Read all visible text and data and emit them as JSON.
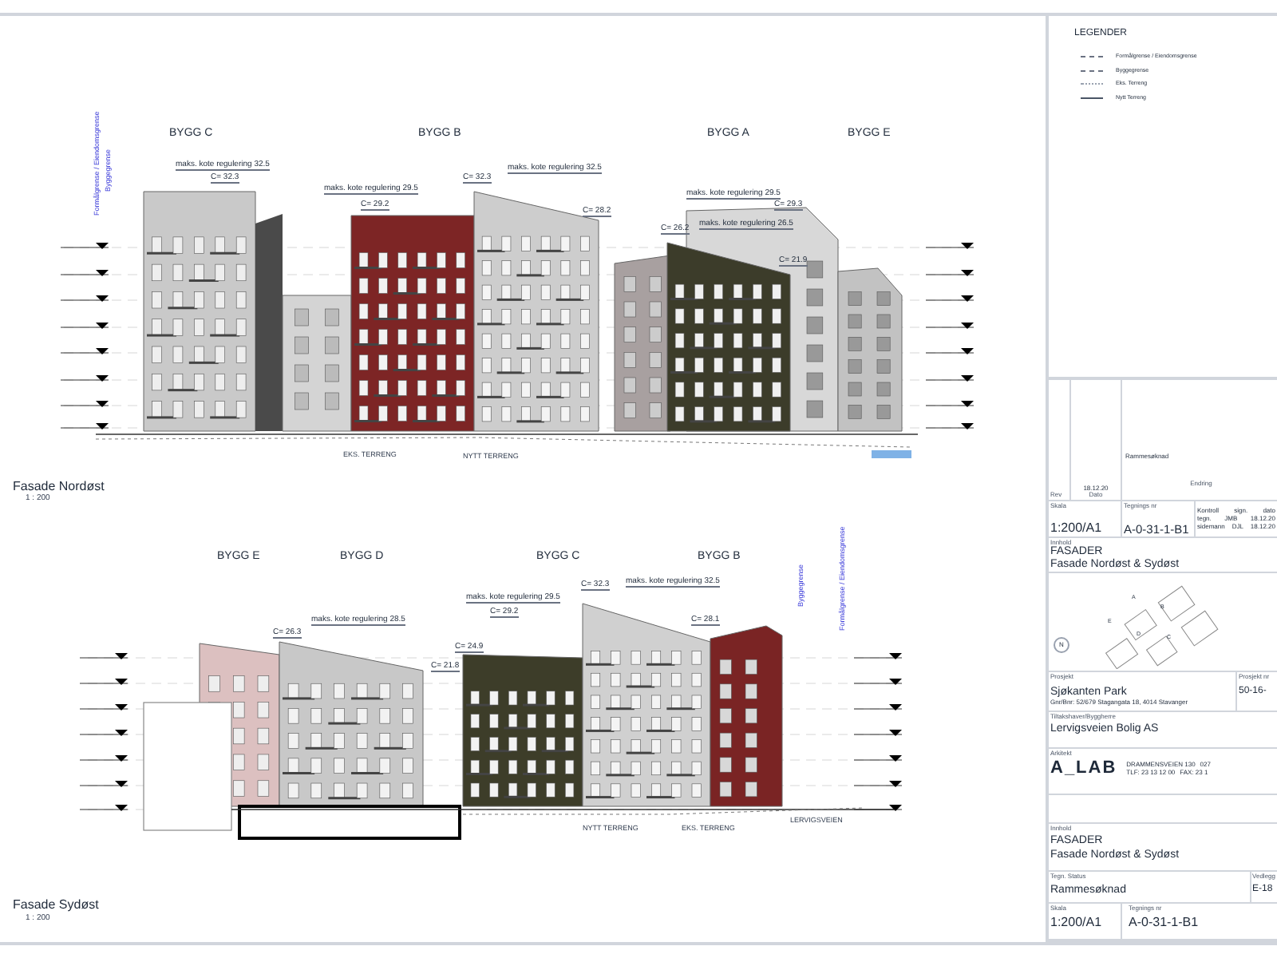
{
  "facades": [
    {
      "title": "Fasade Nordøst",
      "scale": "1 : 200",
      "buildings": [
        "BYGG C",
        "BYGG B",
        "BYGG A",
        "BYGG E"
      ],
      "annotations": [
        "maks. kote regulering 32.5",
        "C= 32.3",
        "maks. kote regulering 29.5",
        "C= 29.2",
        "C= 32.3",
        "maks. kote regulering 32.5",
        "C= 28.2",
        "maks. kote regulering 29.5",
        "C= 29.3",
        "maks. kote regulering 26.5",
        "C= 26.2",
        "C= 21.9"
      ],
      "terrain_labels": [
        "EKS. TERRENG",
        "NYTT TERRENG"
      ],
      "boundary_labels": [
        "Formålgrense / Eiendomsgrense",
        "Byggegrense"
      ]
    },
    {
      "title": "Fasade Sydøst",
      "scale": "1 : 200",
      "buildings": [
        "BYGG E",
        "BYGG D",
        "BYGG C",
        "BYGG B"
      ],
      "annotations": [
        "maks. kote regulering 28.5",
        "C= 26.3",
        "C= 21.8",
        "C= 24.9",
        "maks. kote regulering 29.5",
        "C= 29.2",
        "C= 32.3",
        "maks. kote regulering 32.5",
        "C= 28.1"
      ],
      "terrain_labels": [
        "NYTT TERRENG",
        "EKS. TERRENG",
        "LERVIGSVEIEN"
      ],
      "boundary_labels": [
        "Byggegrense",
        "Formålgrense / Eiendomsgrense"
      ]
    }
  ],
  "legend": {
    "title": "LEGENDER",
    "items": [
      {
        "label": "Formålgrense / Eiendomsgrense",
        "kind": "dashed"
      },
      {
        "label": "Byggegrense",
        "kind": "dashed"
      },
      {
        "label": "Eks. Terreng",
        "kind": "dotted"
      },
      {
        "label": "Nytt Terreng",
        "kind": "solid"
      }
    ]
  },
  "revision": {
    "date": "18.12.20",
    "change": "Rammesøknad",
    "headers": [
      "Rev",
      "Dato",
      "Endring"
    ]
  },
  "scale_row": {
    "scale_label": "Skala",
    "scale": "1:200/A1",
    "drawing_no_label": "Tegnings nr",
    "drawing_no": "A-0-31-1-B1",
    "control": [
      [
        "Kontroll",
        "sign.",
        "dato"
      ],
      [
        "tegn.",
        "JMB",
        "18.12.20"
      ],
      [
        "sidemann",
        "DJL",
        "18.12.20"
      ]
    ]
  },
  "content": {
    "label": "Innhold",
    "title": "FASADER",
    "subtitle": "Fasade Nordøst & Sydøst"
  },
  "site_plan": {
    "north": "N",
    "buildings": [
      "E",
      "A",
      "B",
      "D",
      "C"
    ]
  },
  "project": {
    "label": "Prosjekt",
    "name": "Sjøkanten Park",
    "address": "Gnr/Bnr: 52/679 Stagangata 18, 4014 Stavanger",
    "number_label": "Prosjekt nr",
    "number": "50-16-"
  },
  "client": {
    "label": "Tiltakshaver/Byggherre",
    "name": "Lervigsveien Bolig AS"
  },
  "architect": {
    "label": "Arkitekt",
    "logo": "A_LAB",
    "address": "DRAMMENSVEIEN 130",
    "address_cut": "027",
    "phone": "TLF: 23 13 12 00",
    "fax": "FAX: 23 1"
  },
  "content_repeat": {
    "label": "Innhold",
    "title": "FASADER",
    "subtitle": "Fasade Nordøst & Sydøst"
  },
  "status": {
    "label": "Tegn. Status",
    "value": "Rammesøknad",
    "attachment_label": "Vedlegg",
    "attachment": "E-18"
  },
  "footer": {
    "scale_label": "Skala",
    "scale": "1:200/A1",
    "drawing_no_label": "Tegnings nr",
    "drawing_no": "A-0-31-1-B1"
  }
}
